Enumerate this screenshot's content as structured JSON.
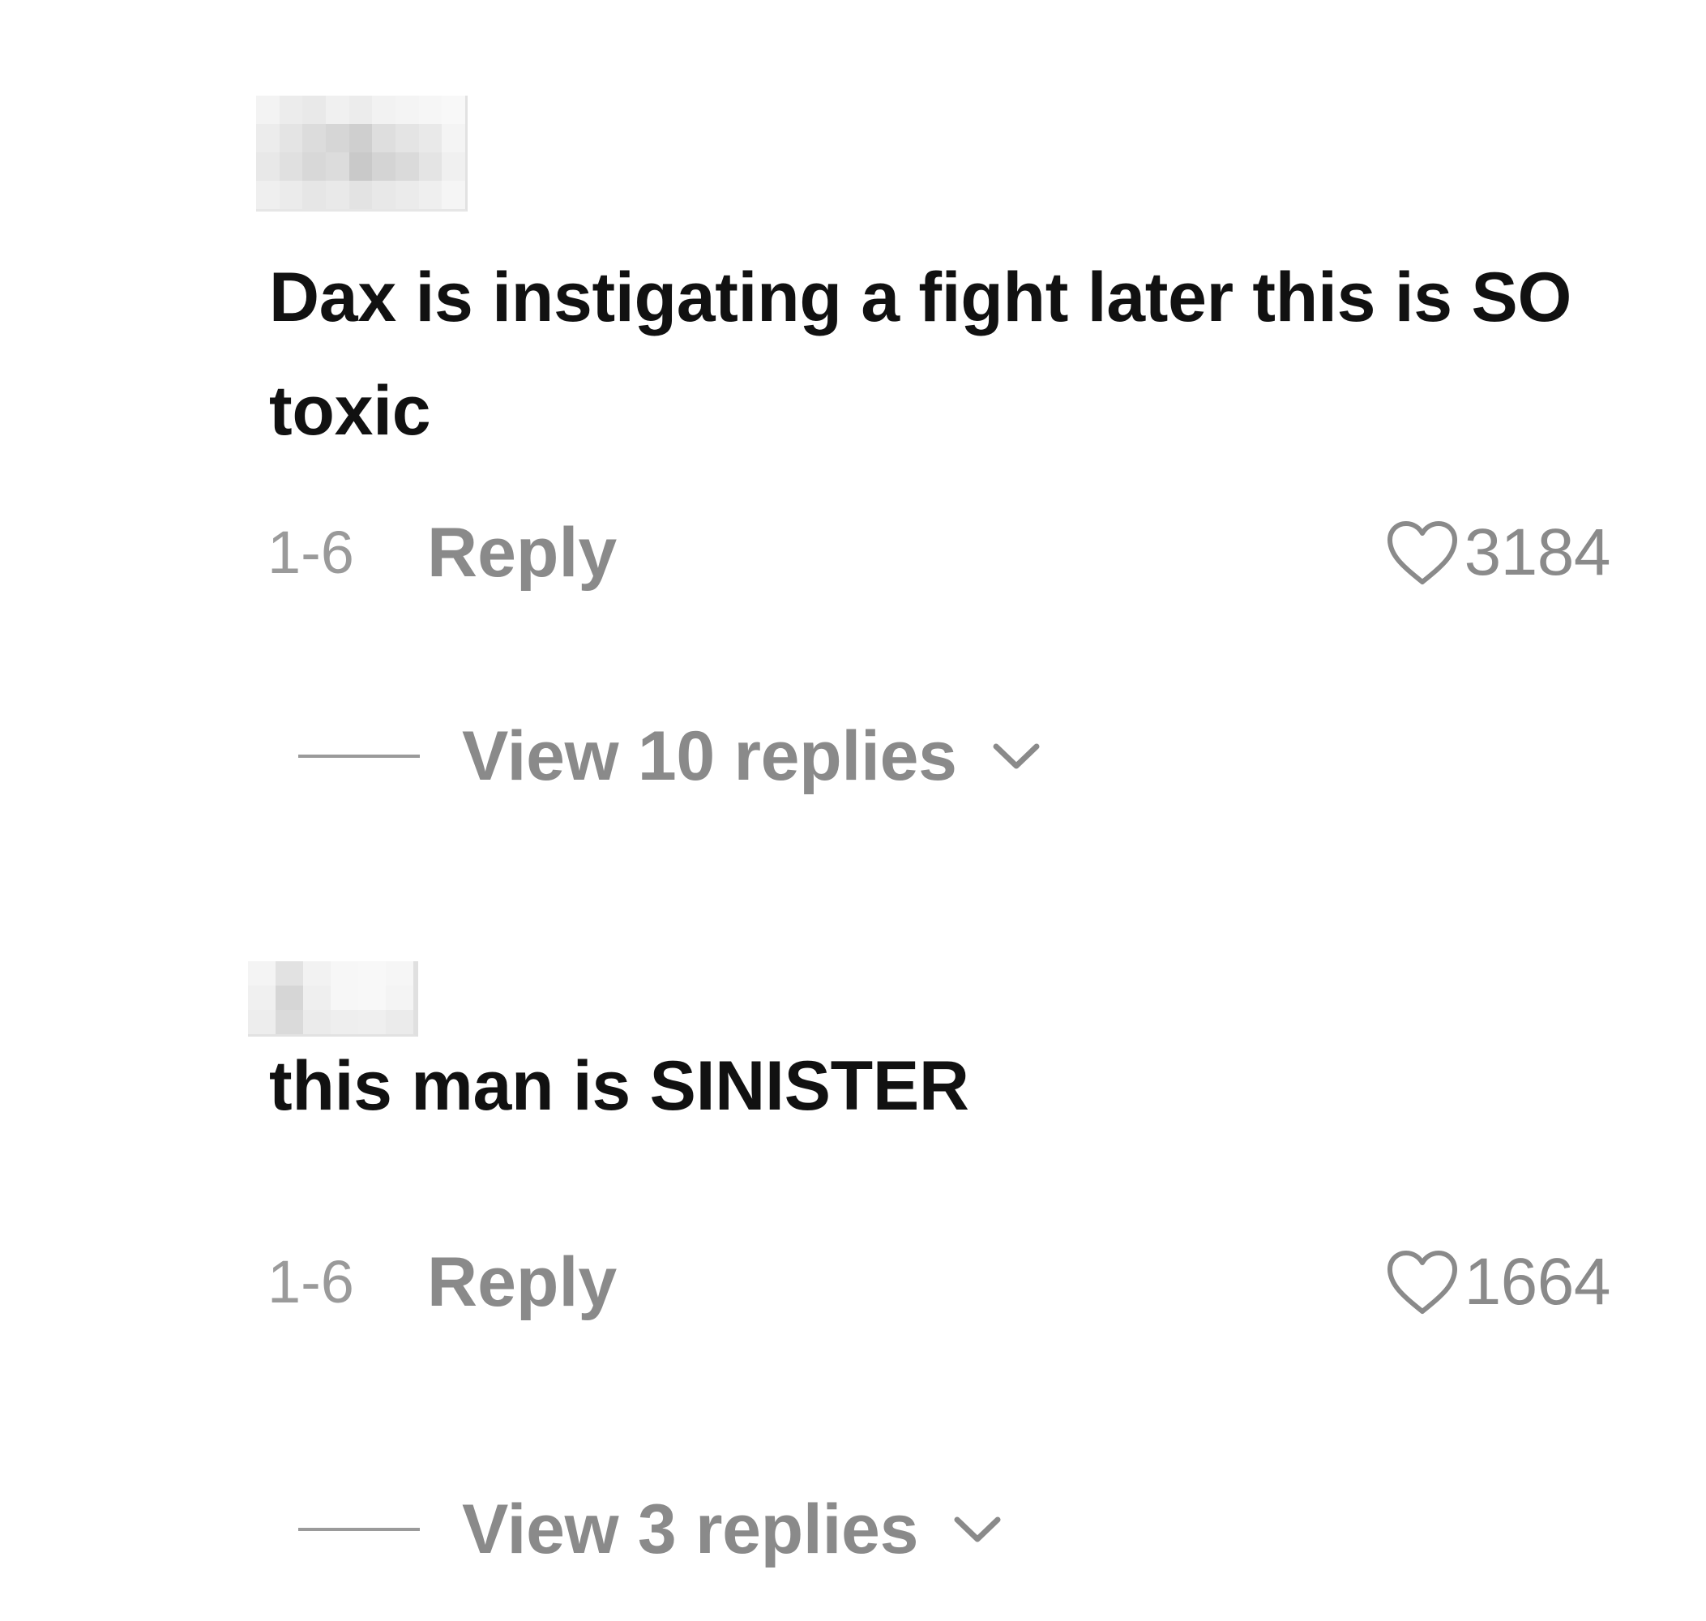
{
  "comments": [
    {
      "text": "Dax is instigating a fight later this is SO toxic",
      "date": "1-6",
      "reply_label": "Reply",
      "likes": "3184",
      "view_replies_label": "View 10 replies"
    },
    {
      "text": "this man is SINISTER",
      "date": "1-6",
      "reply_label": "Reply",
      "likes": "1664",
      "view_replies_label": "View 3 replies"
    }
  ],
  "icons": {
    "like": "heart-outline-icon",
    "expand": "chevron-down-icon"
  },
  "colors": {
    "text_primary": "#111111",
    "text_secondary": "#8a8a8a",
    "date": "#9a9a9a",
    "background": "#ffffff"
  }
}
